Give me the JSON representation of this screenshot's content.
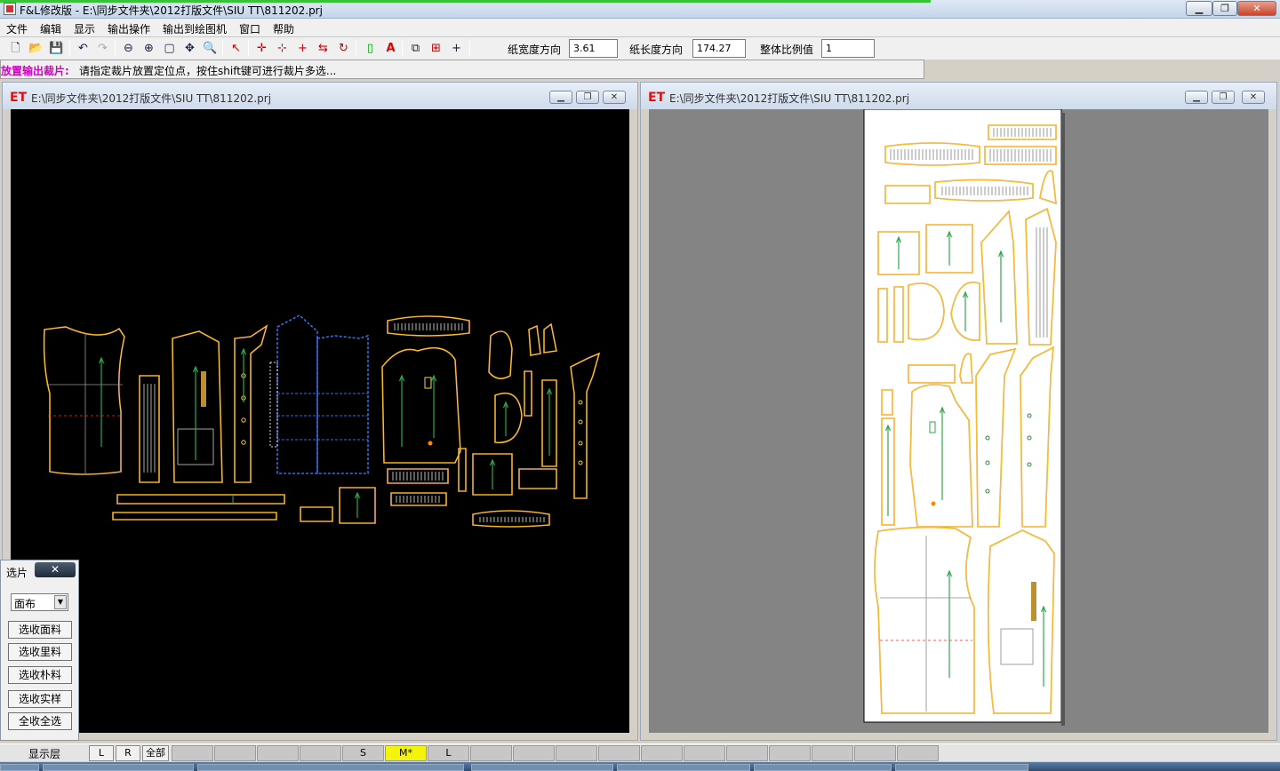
{
  "window": {
    "title": "F&L修改版 - E:\\同步文件夹\\2012打版文件\\SIU TT\\811202.prj",
    "minimize": "▁",
    "restore": "❐",
    "close": "✕"
  },
  "menu": [
    "文件",
    "编辑",
    "显示",
    "输出操作",
    "输出到绘图机",
    "窗口",
    "帮助"
  ],
  "toolbar": {
    "paper_width_label": "纸宽度方向",
    "paper_width_value": "3.61",
    "paper_length_label": "纸长度方向",
    "paper_length_value": "174.27",
    "scale_label": "整体比例值",
    "scale_value": "1"
  },
  "status": {
    "mode": "放置输出裁片:",
    "hint": "请指定裁片放置定位点，按住shift键可进行裁片多选..."
  },
  "left_window": {
    "logo": "ET",
    "path": "E:\\同步文件夹\\2012打版文件\\SIU TT\\811202.prj"
  },
  "right_window": {
    "logo": "ET",
    "path": "E:\\同步文件夹\\2012打版文件\\SIU TT\\811202.prj"
  },
  "select_panel": {
    "title": "选片",
    "close": "✕",
    "fabric_value": "面布",
    "buttons": [
      "选收面料",
      "选收里料",
      "选收朴料",
      "选收实样",
      "全收全选"
    ]
  },
  "layers": {
    "label": "显示层",
    "buttons": [
      "L",
      "R",
      "全部"
    ],
    "sizes": [
      "",
      "",
      "",
      "",
      "S",
      "M*",
      "L",
      "",
      "",
      "",
      "",
      "",
      "",
      "",
      "",
      "",
      "",
      ""
    ]
  },
  "colors": {
    "piece_outline": "#f0a020",
    "piece_inner": "#ffd040",
    "grain_line": "#2ea84a",
    "lining_outline": "#3070e0",
    "left_bg": "#000000",
    "right_bg": "#848484",
    "paper": "#ffffff",
    "active_size": "#f4f40a",
    "status_mode": "#d000c0"
  }
}
